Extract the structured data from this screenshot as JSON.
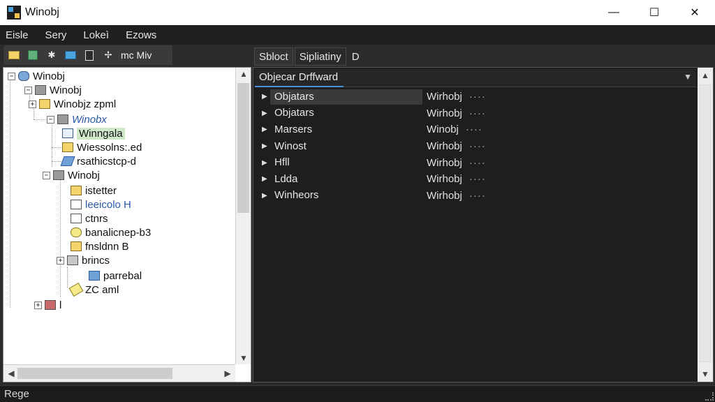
{
  "window": {
    "title": "Winobj",
    "minimize": "—",
    "maximize": "☐",
    "close": "✕"
  },
  "menu": [
    "Eisle",
    "Sery",
    "Lokeì",
    "Ezows"
  ],
  "toolbar": {
    "label": "mc Miv"
  },
  "tree": {
    "items": [
      {
        "label": "Winobj"
      },
      {
        "label": "Winobj"
      },
      {
        "label": "Winobjz zpml"
      },
      {
        "label": "Winobx"
      },
      {
        "label": "Winngala"
      },
      {
        "label": "Wiessolns:.ed"
      },
      {
        "label": "rsathicstcp-d"
      },
      {
        "label": "Winobj"
      },
      {
        "label": "istetter"
      },
      {
        "label": "leeicolo H"
      },
      {
        "label": "ctnrs"
      },
      {
        "label": "banalicnep-b3"
      },
      {
        "label": "fnsldnn B"
      },
      {
        "label": "brincs"
      },
      {
        "label": "parrebal"
      },
      {
        "label": "ZC aml"
      },
      {
        "label": "l"
      }
    ]
  },
  "tabs": [
    {
      "label": "Sbloct"
    },
    {
      "label": "Sipliatiny"
    },
    {
      "label": "D"
    }
  ],
  "right": {
    "dropdown_label": "Objecar Drffward",
    "rows": [
      {
        "name": "Objatars",
        "value": "Wirhobj",
        "dots": "····"
      },
      {
        "name": "Objatars",
        "value": "Wirhobj",
        "dots": "····"
      },
      {
        "name": "Marsers",
        "value": "Winobj",
        "dots": "····"
      },
      {
        "name": "Winost",
        "value": "Wirhobj",
        "dots": "····"
      },
      {
        "name": "Hfll",
        "value": "Wirhobj",
        "dots": "····"
      },
      {
        "name": "Ldda",
        "value": "Wirhobj",
        "dots": "····"
      },
      {
        "name": "Winheors",
        "value": "Wirhobj",
        "dots": "····"
      }
    ]
  },
  "status": {
    "text": "Rege"
  },
  "colors": {
    "selection_green": "#cfe8c9",
    "link_blue": "#2a5aa8",
    "folder_yellow": "#f2d46b"
  }
}
